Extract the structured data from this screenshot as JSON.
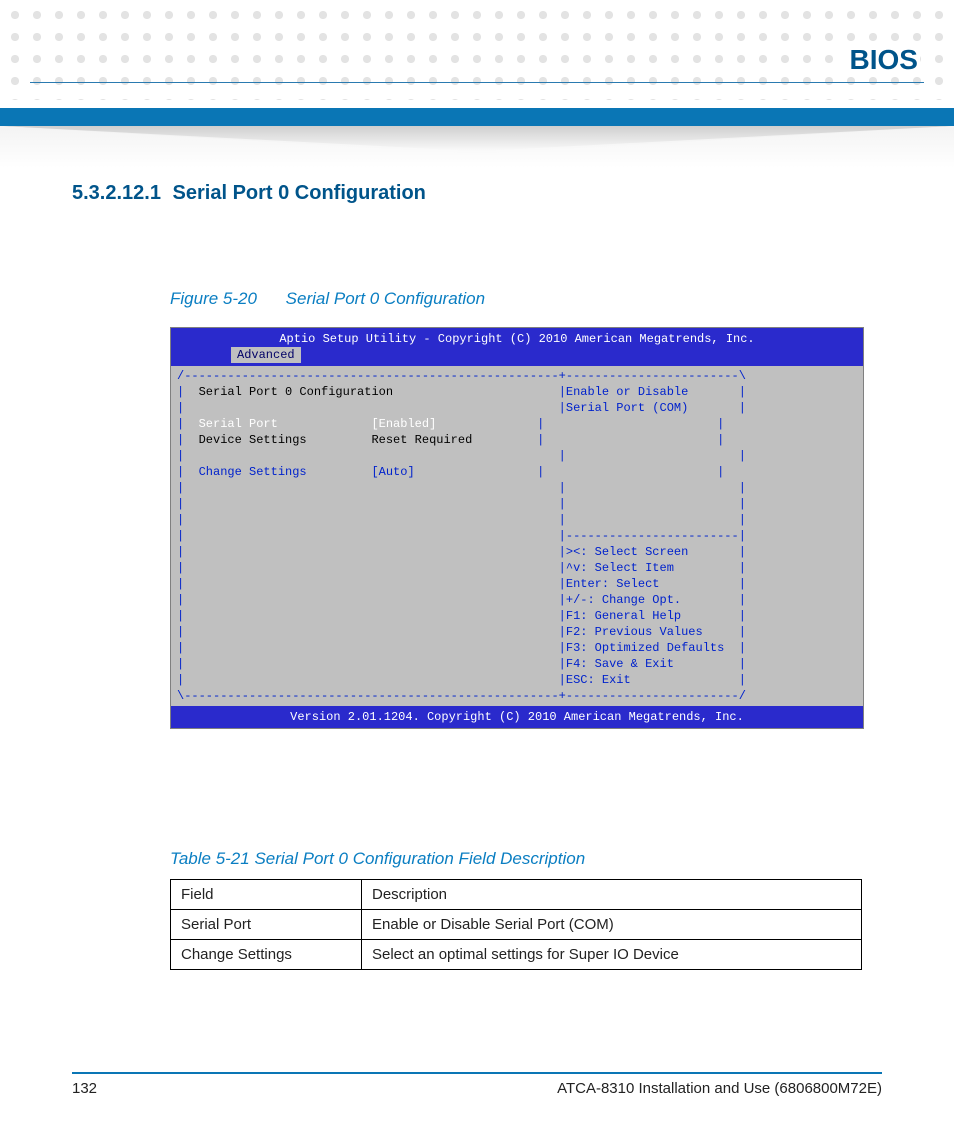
{
  "header": {
    "title": "BIOS"
  },
  "section": {
    "number": "5.3.2.12.1",
    "title": "Serial Port 0 Configuration"
  },
  "figure": {
    "id": "Figure 5-20",
    "title": "Serial Port 0 Configuration"
  },
  "bios": {
    "top": "Aptio Setup Utility - Copyright (C) 2010 American Megatrends, Inc.",
    "tab": "Advanced",
    "screen_title": "Serial Port 0 Configuration",
    "items": [
      {
        "label": "Serial Port",
        "value": "[Enabled]",
        "selected": true
      },
      {
        "label": "Device Settings",
        "value": "Reset Required",
        "selected": false
      },
      {
        "label": "Change Settings",
        "value": "[Auto]",
        "selected": false
      }
    ],
    "help_text": [
      "Enable or Disable",
      "Serial Port (COM)"
    ],
    "nav": [
      "><: Select Screen",
      "^v: Select Item",
      "Enter: Select",
      "+/-: Change Opt.",
      "F1: General Help",
      "F2: Previous Values",
      "F3: Optimized Defaults",
      "F4: Save & Exit",
      "ESC: Exit"
    ],
    "bottom": "Version 2.01.1204. Copyright (C) 2010 American Megatrends, Inc."
  },
  "table": {
    "caption_id": "Table 5-21",
    "caption_title": "Serial Port 0 Configuration Field Description",
    "header": {
      "c1": "Field",
      "c2": "Description"
    },
    "rows": [
      {
        "c1": "Serial Port",
        "c2": "Enable or Disable Serial Port (COM)"
      },
      {
        "c1": "Change Settings",
        "c2": "Select an optimal settings for Super IO Device"
      }
    ]
  },
  "footer": {
    "page": "132",
    "doc": "ATCA-8310 Installation and Use (6806800M72E)"
  }
}
